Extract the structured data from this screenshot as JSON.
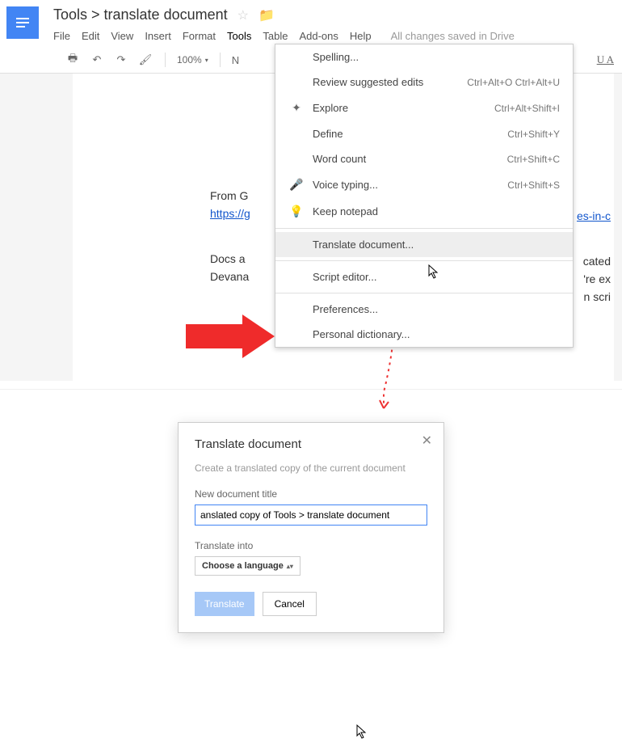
{
  "header": {
    "title": "Tools > translate document",
    "save_status": "All changes saved in Drive"
  },
  "menubar": [
    "File",
    "Edit",
    "View",
    "Insert",
    "Format",
    "Tools",
    "Table",
    "Add-ons",
    "Help"
  ],
  "toolbar": {
    "zoom": "100%",
    "font_abbr": "N",
    "right_glyph": "U  A"
  },
  "dropdown": [
    {
      "label": "Spelling...",
      "shortcut": "",
      "icon": ""
    },
    {
      "label": "Review suggested edits",
      "shortcut": "Ctrl+Alt+O Ctrl+Alt+U",
      "icon": ""
    },
    {
      "label": "Explore",
      "shortcut": "Ctrl+Alt+Shift+I",
      "icon": "explore"
    },
    {
      "label": "Define",
      "shortcut": "Ctrl+Shift+Y",
      "icon": ""
    },
    {
      "label": "Word count",
      "shortcut": "Ctrl+Shift+C",
      "icon": ""
    },
    {
      "label": "Voice typing...",
      "shortcut": "Ctrl+Shift+S",
      "icon": "mic"
    },
    {
      "label": "Keep notepad",
      "shortcut": "",
      "icon": "bulb"
    },
    {
      "sep": true
    },
    {
      "label": "Translate document...",
      "shortcut": "",
      "icon": "",
      "hl": true
    },
    {
      "sep": true
    },
    {
      "label": "Script editor...",
      "shortcut": "",
      "icon": ""
    },
    {
      "sep": true
    },
    {
      "label": "Preferences...",
      "shortcut": "",
      "icon": ""
    },
    {
      "label": "Personal dictionary...",
      "shortcut": "",
      "icon": ""
    }
  ],
  "page": {
    "line1_pre": "From G",
    "link1": "https://g",
    "link2_suffix": "es-in-c",
    "line2_a": "Docs a",
    "line2_b": "Devana",
    "right1": "cated",
    "right2": "'re ex",
    "right3": "n scri"
  },
  "dialog": {
    "title": "Translate document",
    "subtitle": "Create a translated copy of the current document",
    "field_label": "New document title",
    "field_value": "anslated copy of Tools > translate document",
    "lang_label": "Translate into",
    "lang_select": "Choose a language",
    "btn_primary": "Translate",
    "btn_cancel": "Cancel"
  }
}
